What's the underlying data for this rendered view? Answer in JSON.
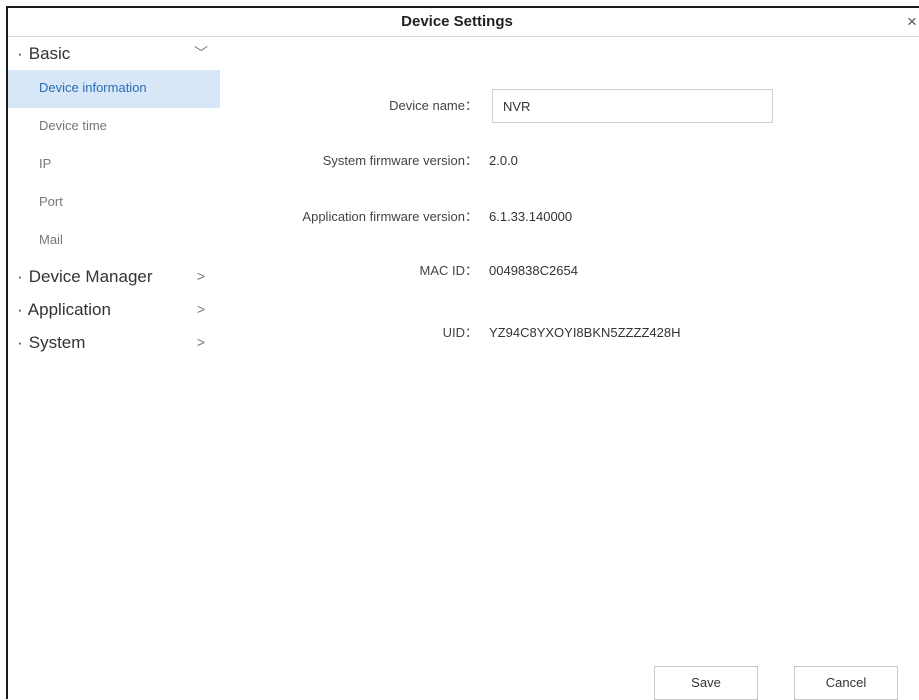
{
  "window": {
    "title": "Device Settings",
    "close_glyph": "×"
  },
  "sidebar": {
    "groups": [
      {
        "bullet": "·",
        "label": "Basic",
        "chevron": "﹀",
        "expanded": true,
        "items": [
          {
            "label": "Device information",
            "active": true
          },
          {
            "label": "Device time",
            "active": false
          },
          {
            "label": "IP",
            "active": false
          },
          {
            "label": "Port",
            "active": false
          },
          {
            "label": "Mail",
            "active": false
          }
        ]
      },
      {
        "bullet": "·",
        "label": "Device Manager",
        "chevron": ">",
        "expanded": false
      },
      {
        "bullet": "·",
        "label": "Application",
        "chevron": ">",
        "expanded": false
      },
      {
        "bullet": "·",
        "label": "System",
        "chevron": ">",
        "expanded": false
      }
    ]
  },
  "device_info": {
    "device_name": {
      "label": "Device name：",
      "value": "NVR"
    },
    "system_firmware": {
      "label": "System firmware version：",
      "value": "2.0.0"
    },
    "app_firmware": {
      "label": "Application firmware version：",
      "value": "6.1.33.140000"
    },
    "mac_id": {
      "label": "MAC ID：",
      "value": "0049838C2654"
    },
    "uid": {
      "label": "UID：",
      "value": "YZ94C8YXOYI8BKN5ZZZZ428H"
    }
  },
  "footer": {
    "save_label": "Save",
    "cancel_label": "Cancel"
  },
  "colors": {
    "active_item_bg": "#d7e7f7",
    "active_item_text": "#2a6db5",
    "window_border": "#1a1a1a"
  }
}
